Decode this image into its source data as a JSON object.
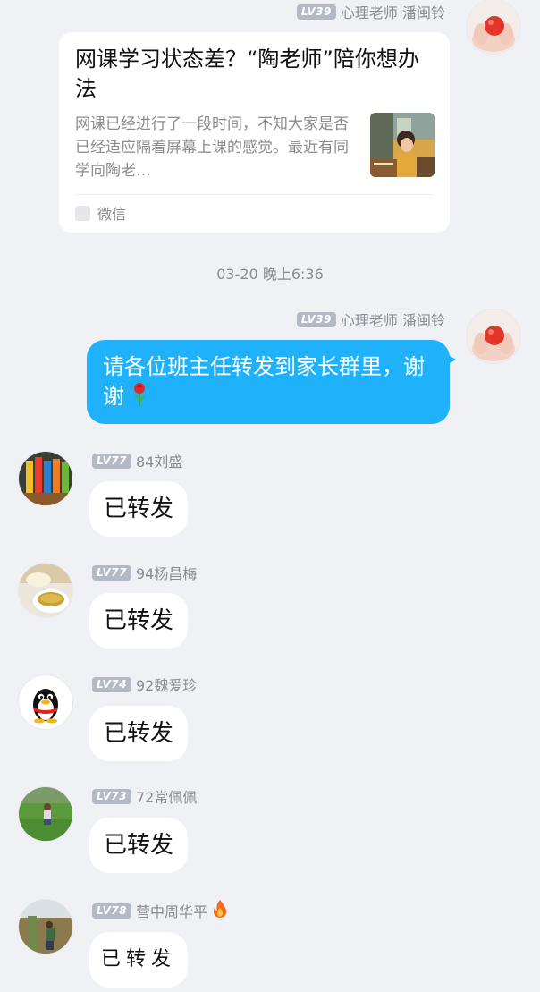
{
  "card": {
    "sender": {
      "level": "LV39",
      "name": "心理老师 潘闽铃"
    },
    "title": "网课学习状态差？“陶老师”陪你想办法",
    "description": "网课已经进行了一段时间，不知大家是否已经适应隔着屏幕上课的感觉。最近有同学向陶老…",
    "source": "微信",
    "source_icon": "wechat-icon"
  },
  "timestamp": "03-20 晚上6:36",
  "outgoing": {
    "sender": {
      "level": "LV39",
      "name": "心理老师 潘闽铃"
    },
    "text": "请各位班主任转发到家长群里，谢谢",
    "emoji": "rose-emoji",
    "bubble_color": "#1fb2fb"
  },
  "messages": [
    {
      "level": "LV77",
      "name": "84刘盛",
      "text": "已转发",
      "avatar": "colored-pencils-avatar"
    },
    {
      "level": "LV77",
      "name": "94杨昌梅",
      "text": "已转发",
      "avatar": "tea-cup-avatar"
    },
    {
      "level": "LV74",
      "name": "92魏爱珍",
      "text": "已转发",
      "avatar": "penguin-avatar"
    },
    {
      "level": "LV73",
      "name": "72常佩佩",
      "text": "已转发",
      "avatar": "lawn-photo-avatar"
    },
    {
      "level": "LV78",
      "name": "营中周华平",
      "text": "已转发",
      "avatar": "outdoor-photo-avatar",
      "badge": "fire-emoji"
    }
  ],
  "colors": {
    "background": "#f0f1f5",
    "level_badge": "#b4b9c6",
    "meta_text": "#8a8c94"
  }
}
